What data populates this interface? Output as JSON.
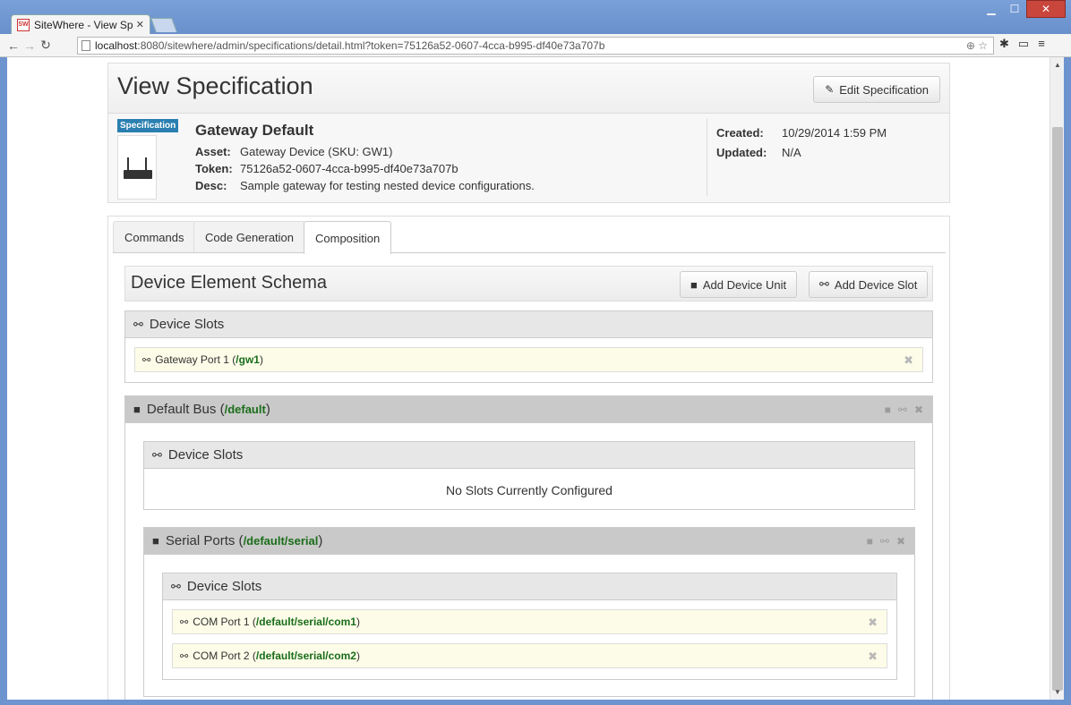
{
  "browser": {
    "tab_title": "SiteWhere - View Sp",
    "favicon": "SW",
    "url_host": "localhost",
    "url_path": ":8080/sitewhere/admin/specifications/detail.html?token=75126a52-0607-4cca-b995-df40e73a707b"
  },
  "page": {
    "title": "View Specification",
    "edit_label": "Edit Specification"
  },
  "spec": {
    "badge": "Specification",
    "name": "Gateway Default",
    "asset_label": "Asset:",
    "asset": "Gateway Device (SKU: GW1)",
    "token_label": "Token:",
    "token": "75126a52-0607-4cca-b995-df40e73a707b",
    "desc_label": "Desc:",
    "desc": "Sample gateway for testing nested device configurations.",
    "created_label": "Created:",
    "created": "10/29/2014 1:59 PM",
    "updated_label": "Updated:",
    "updated": "N/A"
  },
  "tabs": [
    "Commands",
    "Code Generation",
    "Composition"
  ],
  "active_tab": "Composition",
  "schema": {
    "title": "Device Element Schema",
    "add_unit_label": "Add Device Unit",
    "add_slot_label": "Add Device Slot",
    "root_slots": {
      "title": "Device Slots",
      "slots": [
        {
          "name": "Gateway Port 1",
          "path": "/gw1"
        }
      ]
    },
    "default_bus": {
      "name": "Default Bus",
      "path": "/default",
      "slots_title": "Device Slots",
      "empty_message": "No Slots Currently Configured",
      "serial": {
        "name": "Serial Ports",
        "path": "/default/serial",
        "slots_title": "Device Slots",
        "slots": [
          {
            "name": "COM Port 1",
            "path": "/default/serial/com1"
          },
          {
            "name": "COM Port 2",
            "path": "/default/serial/com2"
          }
        ]
      }
    }
  },
  "colors": {
    "path_green": "#1a6d1a",
    "badge_blue": "#2a7fb0",
    "slot_bg": "#fcfce8"
  }
}
